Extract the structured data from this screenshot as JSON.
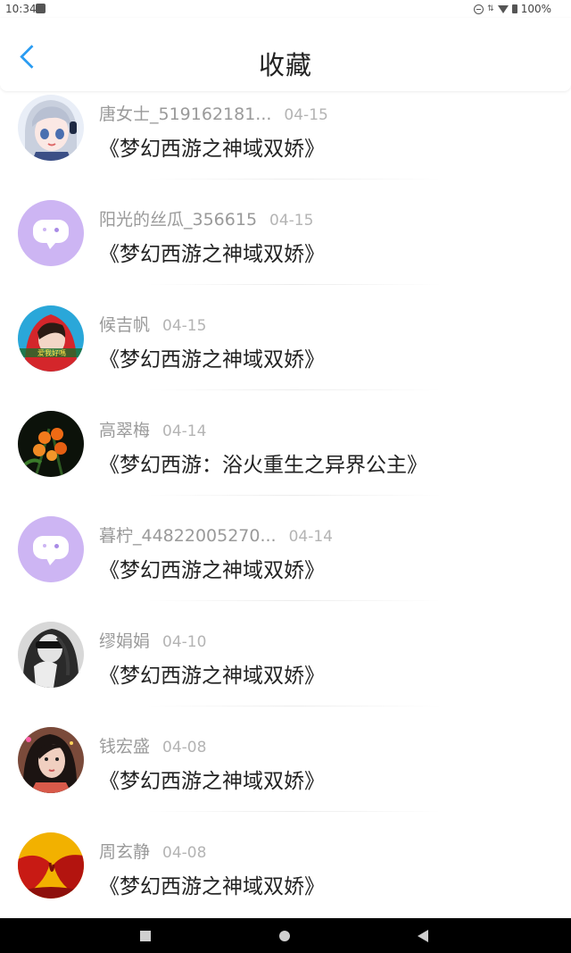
{
  "status_bar": {
    "time": "10:34",
    "battery": "100%"
  },
  "header": {
    "title": "收藏"
  },
  "favorites": [
    {
      "user": "唐女士_519162181...",
      "date": "04-15",
      "work": "《梦幻西游之神域双娇》",
      "avatar": "anime-girl-avatar"
    },
    {
      "user": "阳光的丝瓜_356615",
      "date": "04-15",
      "work": "《梦幻西游之神域双娇》",
      "avatar": "default-chat-avatar"
    },
    {
      "user": "候吉帆",
      "date": "04-15",
      "work": "《梦幻西游之神域双娇》",
      "avatar": "girl-red-hoodie-avatar"
    },
    {
      "user": "高翠梅",
      "date": "04-14",
      "work": "《梦幻西游：浴火重生之异界公主》",
      "avatar": "orange-flower-avatar"
    },
    {
      "user": "暮柠_44822005270...",
      "date": "04-14",
      "work": "《梦幻西游之神域双娇》",
      "avatar": "default-chat-avatar"
    },
    {
      "user": "缪娟娟",
      "date": "04-10",
      "work": "《梦幻西游之神域双娇》",
      "avatar": "sunglasses-girl-avatar"
    },
    {
      "user": "钱宏盛",
      "date": "04-08",
      "work": "《梦幻西游之神域双娇》",
      "avatar": "girl-portrait-avatar"
    },
    {
      "user": "周玄静",
      "date": "04-08",
      "work": "《梦幻西游之神域双娇》",
      "avatar": "red-yellow-avatar"
    }
  ],
  "colors": {
    "accent": "#2a9cf2",
    "default_avatar": "#cdb5f3"
  }
}
